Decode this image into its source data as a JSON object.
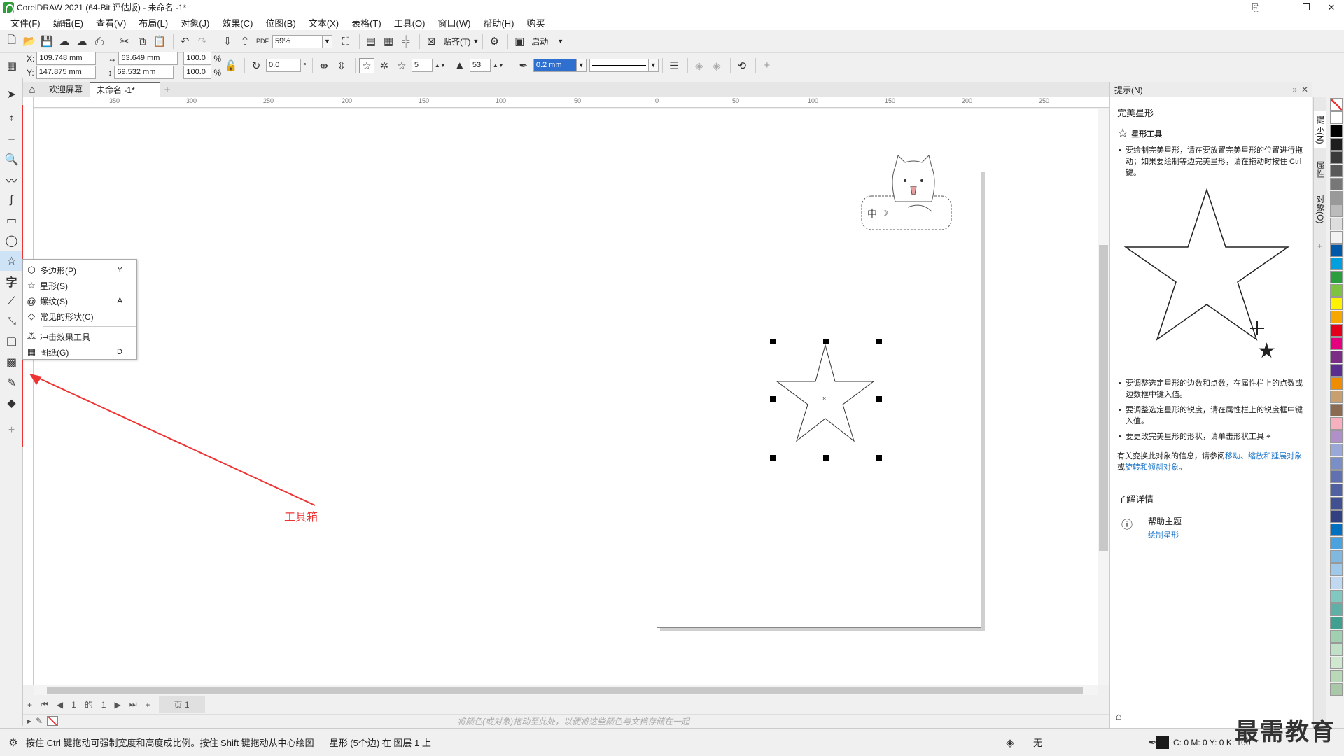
{
  "window": {
    "title": "CorelDRAW 2021 (64-Bit 评估版) - 未命名 -1*"
  },
  "menu": [
    "文件(F)",
    "编辑(E)",
    "查看(V)",
    "布局(L)",
    "对象(J)",
    "效果(C)",
    "位图(B)",
    "文本(X)",
    "表格(T)",
    "工具(O)",
    "窗口(W)",
    "帮助(H)",
    "购买"
  ],
  "toolbar1": {
    "zoom": "59%",
    "snap": "贴齐(T)",
    "launch": "启动"
  },
  "propbar": {
    "x": "109.748 mm",
    "y": "147.875 mm",
    "w": "63.649 mm",
    "h": "69.532 mm",
    "sx": "100.0",
    "sy": "100.0",
    "pct": "%",
    "x_label": "X:",
    "y_label": "Y:",
    "angle": "0.0",
    "points": "5",
    "sharp": "53",
    "outline": "0.2 mm"
  },
  "tabs": {
    "welcome": "欢迎屏幕",
    "doc": "未命名 -1*"
  },
  "ruler_h": [
    "350",
    "300",
    "250",
    "200",
    "150",
    "100",
    "50",
    "0",
    "50",
    "100",
    "150",
    "200",
    "250"
  ],
  "flyout": [
    {
      "label": "多边形(P)",
      "key": "Y",
      "icon": "polygon-icon"
    },
    {
      "label": "星形(S)",
      "key": "",
      "icon": "star-icon"
    },
    {
      "label": "螺纹(S)",
      "key": "A",
      "icon": "spiral-icon"
    },
    {
      "label": "常见的形状(C)",
      "key": "",
      "icon": "shapes-icon"
    },
    {
      "label": "冲击效果工具",
      "key": "",
      "icon": "impact-icon"
    },
    {
      "label": "图纸(G)",
      "key": "D",
      "icon": "graph-paper-icon"
    }
  ],
  "annotation": "工具箱",
  "pagenav": {
    "current": "1",
    "of": "的",
    "total": "1",
    "page_tab": "页 1"
  },
  "docpalette": "将颜色(或对象)拖动至此处，以便将这些颜色与文档存储在一起",
  "status": {
    "hint": "按住 Ctrl 键拖动可强制宽度和高度成比例。按住 Shift 键拖动从中心绘图",
    "object": "星形 (5个边) 在 图层 1 上",
    "fill": "无",
    "color": "C: 0 M: 0 Y: 0 K: 100"
  },
  "hints": {
    "header": "提示(N)",
    "title": "完美星形",
    "tool": "星形工具",
    "p1": "要绘制完美星形，请在要放置完美星形的位置进行拖动；如果要绘制等边完美星形，请在拖动时按住 Ctrl 键。",
    "p2": "要调整选定星形的边数和点数，在属性栏上的点数或边数框中键入值。",
    "p3": "要调整选定星形的锐度，请在属性栏上的锐度框中键入值。",
    "p4": "要更改完美星形的形状，请单击形状工具",
    "p5_pre": "有关变换此对象的信息，请参阅",
    "p5_link1": "移动、缩放和延展对象",
    "p5_mid": "或",
    "p5_link2": "旋转和倾斜对象",
    "p5_end": "。",
    "learn": "了解详情",
    "help_topic": "帮助主题",
    "help_link": "绘制星形"
  },
  "sidetabs": [
    "提示(N)",
    "属性",
    "对象(O)"
  ],
  "palette_colors": [
    "#ffffff",
    "#000000",
    "#1e1e1e",
    "#3a3a3a",
    "#595959",
    "#777777",
    "#999999",
    "#bbbbbb",
    "#dddddd",
    "#f2f2f2",
    "#0058a8",
    "#00a0e0",
    "#2a9d3c",
    "#7ec242",
    "#fff200",
    "#f7a800",
    "#e3001b",
    "#e4007f",
    "#7b2c84",
    "#5b2d8e",
    "#f08c00",
    "#c8a070",
    "#8a6a50",
    "#f6b0c0",
    "#b090c8",
    "#9aa8d8",
    "#7a8fc8",
    "#6070b0",
    "#5060a0",
    "#405090",
    "#304080",
    "#0070c0",
    "#4aa3df",
    "#80b8e0",
    "#a0c8e8",
    "#c0d8f0",
    "#80c8c0",
    "#60b0a8",
    "#40a090",
    "#a0d0b0",
    "#c0e0c8",
    "#d0e8d0",
    "#b8d8b8",
    "#a8c8a8"
  ],
  "watermark": "最需教育"
}
